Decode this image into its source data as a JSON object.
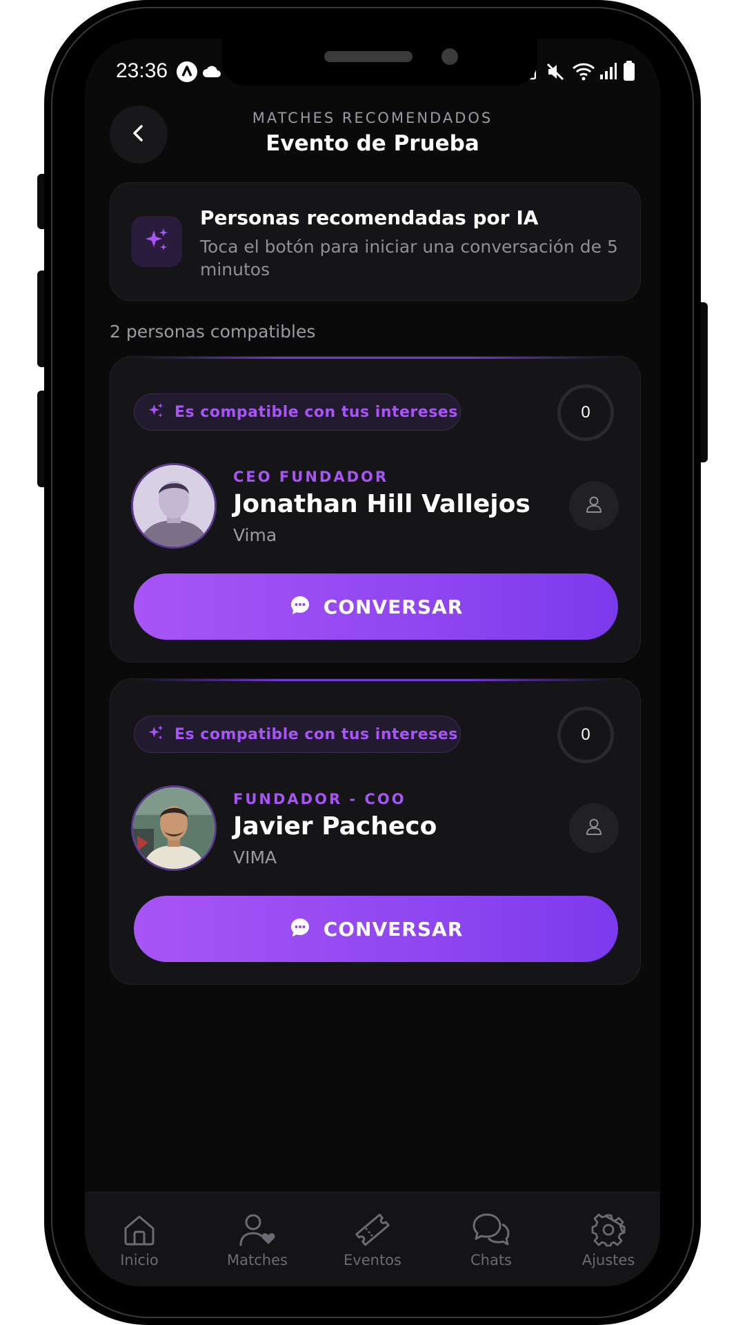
{
  "status_bar": {
    "time": "23:36"
  },
  "header": {
    "overline": "MATCHES RECOMENDADOS",
    "title": "Evento de Prueba"
  },
  "info_card": {
    "title": "Personas recomendadas por IA",
    "subtitle": "Toca el botón para iniciar una conversación de 5 minutos"
  },
  "count_label": "2 personas compatibles",
  "matches": [
    {
      "chip": "Es compatible con tus intereses",
      "score": "0",
      "role": "CEO FUNDADOR",
      "name": "Jonathan Hill Vallejos",
      "company": "Vima",
      "button": "CONVERSAR"
    },
    {
      "chip": "Es compatible con tus intereses",
      "score": "0",
      "role": "FUNDADOR - COO",
      "name": "Javier Pacheco",
      "company": "VIMA",
      "button": "CONVERSAR"
    }
  ],
  "bottom_nav": [
    {
      "label": "Inicio",
      "icon": "home-icon"
    },
    {
      "label": "Matches",
      "icon": "user-heart-icon"
    },
    {
      "label": "Eventos",
      "icon": "ticket-icon"
    },
    {
      "label": "Chats",
      "icon": "chat-bubbles-icon"
    },
    {
      "label": "Ajustes",
      "icon": "gear-icon"
    }
  ],
  "colors": {
    "accent": "#a855f7",
    "accent_dark": "#7c3aed",
    "background": "#0a0a0b",
    "card": "#151518"
  }
}
